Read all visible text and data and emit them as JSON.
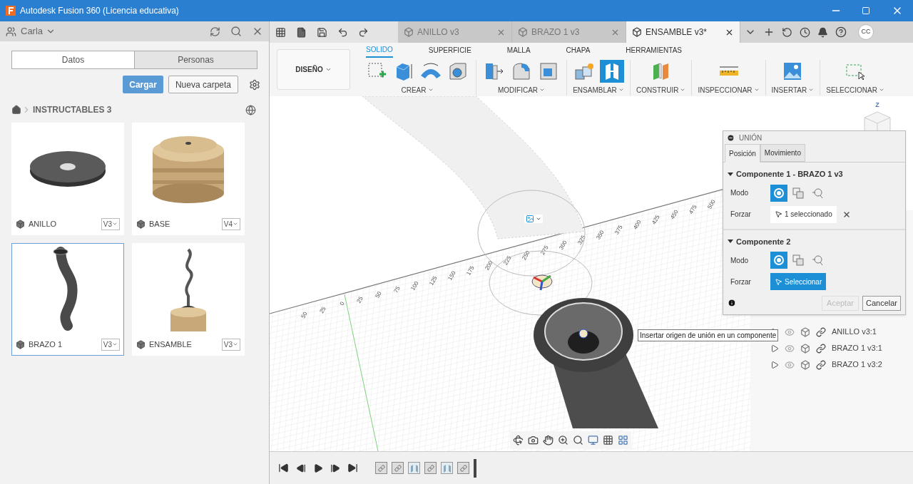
{
  "window": {
    "title": "Autodesk Fusion 360 (Licencia educativa)"
  },
  "data_panel": {
    "user": "Carla",
    "tabs": [
      {
        "label": "Datos",
        "selected": true
      },
      {
        "label": "Personas",
        "selected": false
      }
    ],
    "upload_button": "Cargar",
    "new_folder_button": "Nueva carpeta",
    "breadcrumb": "INSTRUCTABLES 3",
    "files": [
      {
        "name": "ANILLO",
        "version": "V3",
        "kind": "ring",
        "selected": false
      },
      {
        "name": "BASE",
        "version": "V4",
        "kind": "base",
        "selected": false
      },
      {
        "name": "BRAZO 1",
        "version": "V3",
        "kind": "arm",
        "selected": true
      },
      {
        "name": "ENSAMBLE",
        "version": "V3",
        "kind": "assembly",
        "selected": false
      }
    ]
  },
  "document_tabs": [
    {
      "label": "ANILLO v3",
      "selected": false
    },
    {
      "label": "BRAZO 1 v3",
      "selected": false
    },
    {
      "label": "ENSAMBLE v3*",
      "selected": true
    }
  ],
  "avatar": "CC",
  "toolbar": {
    "workspace": "DISEÑO",
    "tabs": [
      {
        "label": "SOLIDO",
        "selected": true
      },
      {
        "label": "SUPERFICIE",
        "selected": false
      },
      {
        "label": "MALLA",
        "selected": false
      },
      {
        "label": "CHAPA",
        "selected": false
      },
      {
        "label": "HERRAMIENTAS",
        "selected": false
      }
    ],
    "groups": [
      {
        "label": "CREAR",
        "tools": [
          {
            "kind": "sketch",
            "selected": false
          },
          {
            "kind": "box",
            "selected": false
          },
          {
            "kind": "sweep",
            "selected": false
          },
          {
            "kind": "hole",
            "selected": false
          }
        ]
      },
      {
        "label": "MODIFICAR",
        "tools": [
          {
            "kind": "presspull",
            "selected": false
          },
          {
            "kind": "fillet",
            "selected": false
          },
          {
            "kind": "shell",
            "selected": false
          }
        ]
      },
      {
        "label": "ENSAMBLAR",
        "tools": [
          {
            "kind": "component",
            "selected": false
          },
          {
            "kind": "joint",
            "selected": true
          }
        ]
      },
      {
        "label": "CONSTRUIR",
        "tools": [
          {
            "kind": "plane",
            "selected": false
          }
        ]
      },
      {
        "label": "INSPECCIONAR",
        "tools": [
          {
            "kind": "measure",
            "selected": false
          }
        ]
      },
      {
        "label": "INSERTAR",
        "tools": [
          {
            "kind": "image",
            "selected": false
          }
        ]
      },
      {
        "label": "SELECCIONAR",
        "tools": [
          {
            "kind": "select",
            "selected": false
          }
        ]
      }
    ]
  },
  "viewport": {
    "viewcube_axis": "Z",
    "ruler_labels": [
      "50",
      "25",
      "0",
      "25",
      "50",
      "75",
      "100",
      "125",
      "150",
      "175",
      "200",
      "225",
      "250",
      "275",
      "300",
      "325",
      "350",
      "375",
      "400",
      "425",
      "450",
      "475",
      "500"
    ],
    "tooltip": "Insertar origen de unión en un componente",
    "tree_rows": [
      {
        "label": "ANILLO v3:1"
      },
      {
        "label": "BRAZO 1 v3:1"
      },
      {
        "label": "BRAZO 1 v3:2"
      }
    ]
  },
  "dialog": {
    "title": "UNIÓN",
    "tabs": [
      {
        "label": "Posición",
        "selected": true
      },
      {
        "label": "Movimiento",
        "selected": false
      }
    ],
    "sections": [
      {
        "title": "Componente 1 - BRAZO 1 v3",
        "mode_label": "Modo",
        "modes": [
          {
            "kind": "simple",
            "selected": true
          },
          {
            "kind": "between",
            "selected": false
          },
          {
            "kind": "center",
            "selected": false
          }
        ],
        "force_label": "Forzar",
        "selection": {
          "text": "1 seleccionado",
          "active": false,
          "clearable": true
        }
      },
      {
        "title": "Componente 2",
        "mode_label": "Modo",
        "modes": [
          {
            "kind": "simple",
            "selected": true
          },
          {
            "kind": "between",
            "selected": false
          },
          {
            "kind": "center",
            "selected": false
          }
        ],
        "force_label": "Forzar",
        "selection": {
          "text": "Seleccionar",
          "active": true,
          "clearable": false
        }
      }
    ],
    "ok_button": {
      "label": "Aceptar",
      "disabled": true
    },
    "cancel_button": "Cancelar"
  },
  "timeline": {
    "features": [
      {
        "kind": "component"
      },
      {
        "kind": "component"
      },
      {
        "kind": "joint"
      },
      {
        "kind": "component"
      },
      {
        "kind": "joint"
      },
      {
        "kind": "component"
      }
    ]
  }
}
